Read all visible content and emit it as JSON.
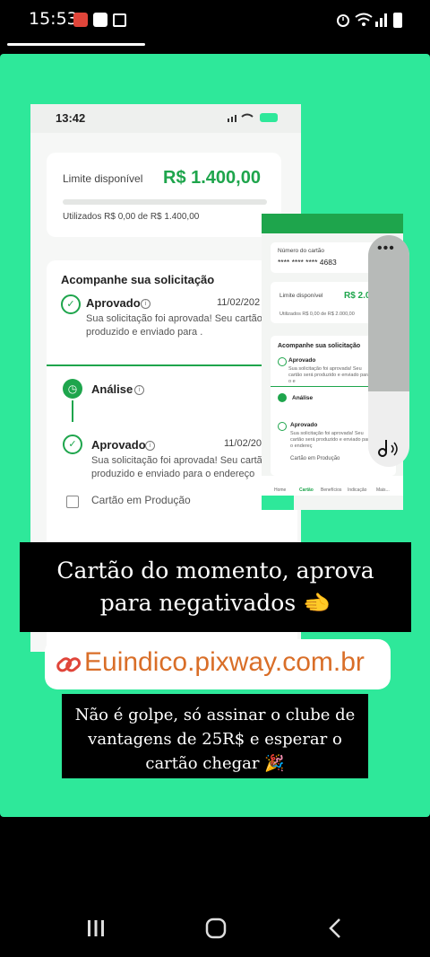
{
  "status_bar": {
    "time": "15:53"
  },
  "phone": {
    "time": "13:42",
    "limit_label": "Limite disponível",
    "limit_value": "R$ 1.400,00",
    "used_text": "Utilizados R$ 0,00 de R$ 1.400,00",
    "track_title": "Acompanhe sua solicitação",
    "approved_label": "Aprovado",
    "approved_date": "11/02/202",
    "approved_text": "Sua solicitação foi aprovada! Seu cartão será produzido e enviado para .",
    "analysis_label": "Análise",
    "approved2_label": "Aprovado",
    "approved2_date": "11/02/202",
    "approved2_text": "Sua solicitação foi aprovada! Seu cartão será produzido e enviado para o endereço",
    "production_label": "Cartão em Produção"
  },
  "mini": {
    "card_number_label": "Número do cartão",
    "card_number": "**** **** **** 4683",
    "limit_label": "Limite disponível",
    "limit_value": "R$ 2.000",
    "used_text": "Utilizados R$ 0,00 de R$ 2.000,00",
    "track_title": "Acompanhe sua solicitação",
    "approved_label": "Aprovado",
    "approved_text": "Sua solicitação foi aprovada! Seu cartão será produzido e enviado para o e",
    "analysis_label": "Análise",
    "approved2_label": "Aprovado",
    "approved2_text": "Sua solicitação foi aprovada! Seu cartão será produzido e enviado para o endereç",
    "production_label": "Cartão em Produção",
    "tabs": [
      "Home",
      "Cartão",
      "Benefícios",
      "Indicação",
      "Mais..."
    ]
  },
  "captions": {
    "main_line1": "Cartão do momento, aprova",
    "main_line2": "para negativados 🫲",
    "link": "Euindico.pixway.com.br",
    "sub_line1": "Não é golpe, só assinar o clube de",
    "sub_line2": "vantagens de 25R$ e esperar o",
    "sub_line3": "cartão chegar 🎉"
  },
  "colors": {
    "accent_green": "#2ee89a",
    "app_green": "#1ea54c",
    "link_orange": "#d96e28"
  }
}
